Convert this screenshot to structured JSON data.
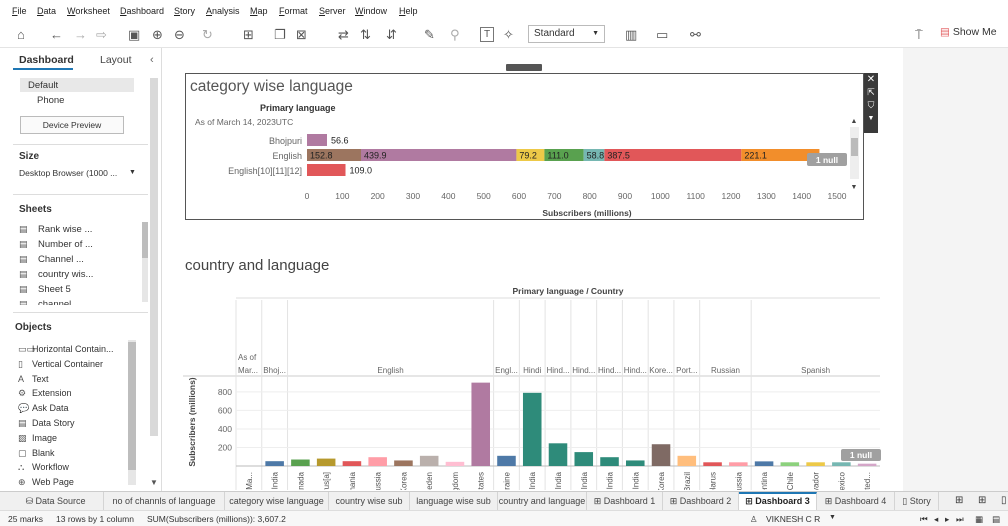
{
  "menu": [
    "File",
    "Data",
    "Worksheet",
    "Dashboard",
    "Story",
    "Analysis",
    "Map",
    "Format",
    "Server",
    "Window",
    "Help"
  ],
  "toolbar": {
    "fit_select": "Standard",
    "show_me": "Show Me"
  },
  "left_panel": {
    "tabs": [
      "Dashboard",
      "Layout"
    ],
    "device_items": [
      "Default",
      "Phone"
    ],
    "device_preview_button": "Device Preview",
    "size_title": "Size",
    "size_value": "Desktop Browser (1000 ...",
    "sheets_title": "Sheets",
    "sheets": [
      "Rank wise ...",
      "Number of ...",
      "Channel ...",
      "country wis...",
      "Sheet 5",
      "channel"
    ],
    "objects_title": "Objects",
    "objects": [
      "Horizontal Contain...",
      "Vertical Container",
      "Text",
      "Extension",
      "Ask Data",
      "Data Story",
      "Image",
      "Blank",
      "Workflow",
      "Web Page"
    ],
    "object_icons": [
      "▭▭",
      "▯",
      "A",
      "⚙",
      "💬",
      "▤",
      "▨",
      "▢",
      "⛬",
      "⊕"
    ]
  },
  "chart1": {
    "title": "category wise language",
    "column_header": "Primary language",
    "as_of": "As of March 14, 2023UTC",
    "null_badge": "1 null",
    "chart_data": {
      "type": "bar",
      "orientation": "horizontal-stacked",
      "categories": [
        "Bhojpuri",
        "English",
        "English[10][11][12]"
      ],
      "stacks": [
        [
          {
            "value": 56.6,
            "color": "#b07aa1",
            "label": "56.6"
          }
        ],
        [
          {
            "value": 152.8,
            "color": "#9c755f",
            "label": "152.8"
          },
          {
            "value": 439.9,
            "color": "#b07aa1",
            "label": "439.9"
          },
          {
            "value": 79.2,
            "color": "#edc948",
            "label": "79.2"
          },
          {
            "value": 111.0,
            "color": "#59a14f",
            "label": "111.0"
          },
          {
            "value": 58.8,
            "color": "#76b7b2",
            "label": "58.8"
          },
          {
            "value": 387.5,
            "color": "#e15759",
            "label": "387.5"
          },
          {
            "value": 221.1,
            "color": "#f28e2b",
            "label": "221.1"
          }
        ],
        [
          {
            "value": 109.0,
            "color": "#e15759",
            "label": "109.0"
          }
        ]
      ],
      "xticks": [
        "0",
        "100",
        "200",
        "300",
        "400",
        "500",
        "600",
        "700",
        "800",
        "900",
        "1000",
        "1100",
        "1200",
        "1300",
        "1400",
        "1500"
      ],
      "xlim": [
        0,
        1500
      ],
      "xlabel": "Subscribers (millions)"
    }
  },
  "chart2": {
    "title": "country and language",
    "header": "Primary language / Country",
    "null_badge": "1 null",
    "chart_data": {
      "type": "bar",
      "language_groups": [
        {
          "label": "As of Mar...",
          "count": 1
        },
        {
          "label": "Bhoj...",
          "count": 1
        },
        {
          "label": "English",
          "count": 8
        },
        {
          "label": "Engl...",
          "count": 1
        },
        {
          "label": "Hindi",
          "count": 1
        },
        {
          "label": "Hind...",
          "count": 1
        },
        {
          "label": "Hind...",
          "count": 1
        },
        {
          "label": "Hind...",
          "count": 1
        },
        {
          "label": "Hind...",
          "count": 1
        },
        {
          "label": "Kore...",
          "count": 1
        },
        {
          "label": "Port...",
          "count": 1
        },
        {
          "label": "Russian",
          "count": 2
        },
        {
          "label": "Spanish",
          "count": 5
        }
      ],
      "categories": [
        "As of Ma...",
        "India",
        "Canada",
        "Cyprus[a]",
        "Romania",
        "Russia",
        "South Korea",
        "Sweden",
        "United Kingdom",
        "United States",
        "Ukraine",
        "India",
        "India",
        "India",
        "India",
        "India",
        "South Korea",
        "Brazil",
        "Belarus",
        "Russia",
        "Argentina",
        "Chile",
        "El Salvador",
        "Mexico",
        "United..."
      ],
      "values": [
        0,
        52,
        70,
        80,
        52,
        95,
        60,
        110,
        45,
        900,
        110,
        790,
        245,
        150,
        95,
        60,
        235,
        110,
        40,
        40,
        50,
        40,
        40,
        40,
        25
      ],
      "colors": [
        "#cccccc",
        "#4e79a7",
        "#59a14f",
        "#b6992d",
        "#e15759",
        "#ff9da7",
        "#9c755f",
        "#bab0ac",
        "#ffbeD2",
        "#b07aa1",
        "#4e79a7",
        "#2e8b7a",
        "#2e8b7a",
        "#2e8b7a",
        "#2e8b7a",
        "#2e8b7a",
        "#7f6a64",
        "#ffbe7d",
        "#e15759",
        "#ff9da7",
        "#4e79a7",
        "#8cd17d",
        "#edc948",
        "#76b7b2",
        "#d4a6c8"
      ],
      "yticks": [
        "200",
        "400",
        "600",
        "800"
      ],
      "ylim": [
        0,
        950
      ],
      "ylabel": "Subscribers (millions)"
    }
  },
  "sheet_tabs": [
    {
      "label": "Data Source",
      "icon": "⛁"
    },
    {
      "label": "no of channls of language",
      "icon": ""
    },
    {
      "label": "category wise language",
      "icon": ""
    },
    {
      "label": "country wise sub",
      "icon": ""
    },
    {
      "label": "language wise sub",
      "icon": ""
    },
    {
      "label": "country and language",
      "icon": ""
    },
    {
      "label": "Dashboard 1",
      "icon": "⊞"
    },
    {
      "label": "Dashboard 2",
      "icon": "⊞"
    },
    {
      "label": "Dashboard 3",
      "icon": "⊞"
    },
    {
      "label": "Dashboard 4",
      "icon": "⊞"
    },
    {
      "label": "Story",
      "icon": "▯"
    }
  ],
  "status": {
    "marks": "25 marks",
    "rows": "13 rows by 1 column",
    "sum": "SUM(Subscribers (millions)): 3,607.2",
    "user": "VIKNESH C R"
  }
}
